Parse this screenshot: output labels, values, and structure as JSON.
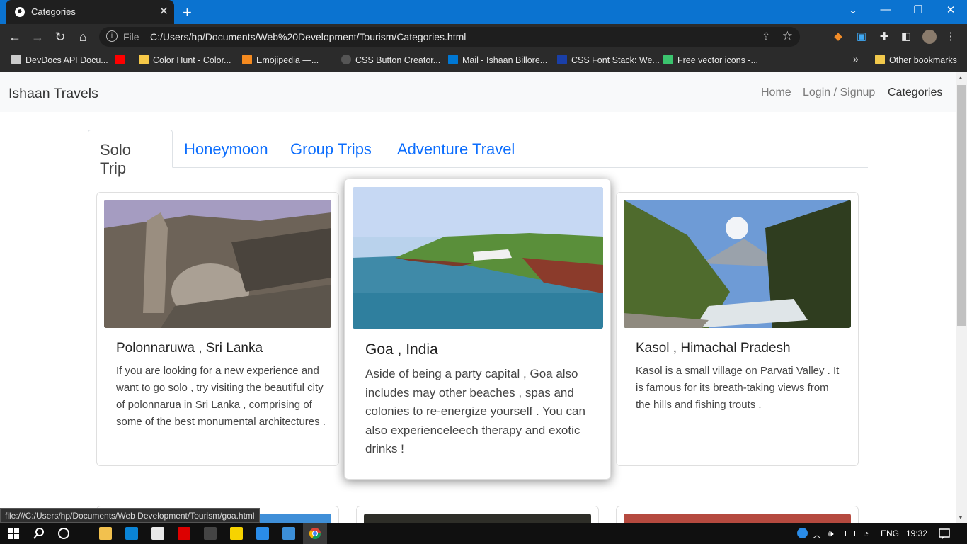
{
  "browser": {
    "tab_title": "Categories",
    "tab_close": "✕",
    "new_tab": "+",
    "url_scheme": "File",
    "url": "C:/Users/hp/Documents/Web%20Development/Tourism/Categories.html",
    "status_url": "file:///C:/Users/hp/Documents/Web Development/Tourism/goa.html",
    "bookmarks": [
      "DevDocs API Docu...",
      "Color Hunt - Color...",
      "Emojipedia —...",
      "CSS Button Creator...",
      "Mail - Ishaan Billore...",
      "CSS Font Stack: We...",
      "Free vector icons -..."
    ],
    "more_bookmarks": "»",
    "other_bookmarks": "Other bookmarks"
  },
  "navbar": {
    "brand": "Ishaan Travels",
    "links": [
      "Home",
      "Login / Signup",
      "Categories"
    ]
  },
  "category_tabs": [
    "Solo Trip",
    "Honeymoon",
    "Group Trips",
    "Adventure Travel"
  ],
  "cards": [
    {
      "title": "Polonnaruwa , Sri Lanka",
      "text": "If you are looking for a new experience and want to go solo , try visiting the beautiful city of polonnarua in Sri Lanka , comprising of some of the best monumental architectures ."
    },
    {
      "title": "Goa , India",
      "text": "Aside of being a party capital , Goa also includes may other beaches , spas and colonies to re-energize yourself . You can also experienceleech therapy and exotic drinks !"
    },
    {
      "title": "Kasol , Himachal Pradesh",
      "text": "Kasol is a small village on Parvati Valley . It is famous for its breath-taking views from the hills and fishing trouts ."
    }
  ],
  "taskbar": {
    "lang": "ENG",
    "time": "19:32"
  },
  "colors": {
    "chrome_blue": "#0b73d0",
    "link_blue": "#0d6efd",
    "navbar_bg": "#f8f9fa"
  }
}
